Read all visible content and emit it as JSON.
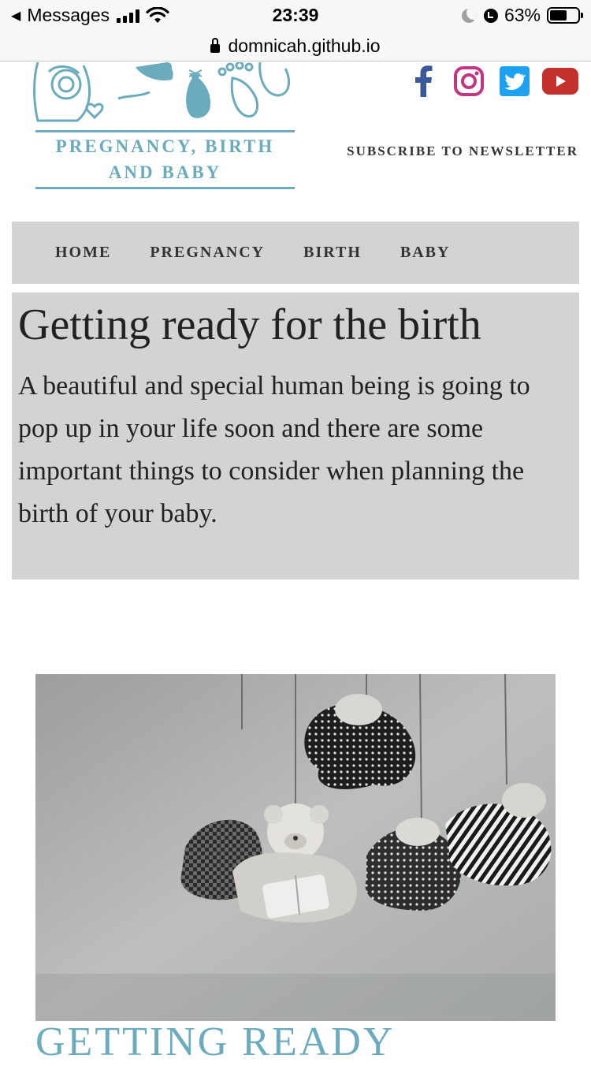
{
  "status_bar": {
    "back_app": "Messages",
    "time": "23:39",
    "battery": "63%",
    "battery_level": 0.63
  },
  "url_bar": {
    "domain": "domnicah.github.io"
  },
  "header": {
    "logo_text": "PREGNANCY, BIRTH AND BABY",
    "subscribe_label": "SUBSCRIBE TO NEWSLETTER",
    "social": [
      {
        "name": "facebook-icon",
        "color": "#3b5998"
      },
      {
        "name": "instagram-icon",
        "color": "#c13584"
      },
      {
        "name": "twitter-icon",
        "color": "#1da1f2"
      },
      {
        "name": "youtube-icon",
        "color": "#c4302b"
      }
    ],
    "brand_color": "#6aacbd"
  },
  "nav": {
    "items": [
      {
        "label": "HOME"
      },
      {
        "label": "PREGNANCY"
      },
      {
        "label": "BIRTH"
      },
      {
        "label": "BABY"
      }
    ]
  },
  "hero": {
    "title": "Getting ready for the birth",
    "text": "A beautiful and special human being is going to pop up in your life soon and there are some important things to consider when planning the birth of your baby."
  },
  "section": {
    "heading": "GETTING READY"
  }
}
